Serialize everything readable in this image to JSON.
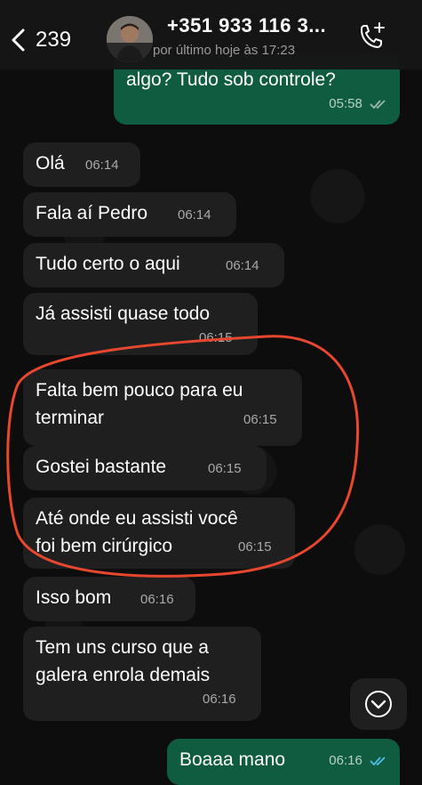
{
  "header": {
    "back_count": "239",
    "contact_name": "+351 933 116 3...",
    "last_seen": "por último hoje às 17:23"
  },
  "messages": [
    {
      "text": "algo? Tudo sob controle?",
      "time": "05:58",
      "direction": "outgoing",
      "read": true
    },
    {
      "text": "Olá",
      "time": "06:14",
      "direction": "incoming"
    },
    {
      "text": "Fala aí Pedro",
      "time": "06:14",
      "direction": "incoming"
    },
    {
      "text": "Tudo certo o aqui",
      "time": "06:14",
      "direction": "incoming"
    },
    {
      "text": "Já assisti quase todo",
      "time": "06:15",
      "direction": "incoming"
    },
    {
      "line1": "Falta bem pouco para eu",
      "line2": "terminar",
      "time": "06:15",
      "direction": "incoming"
    },
    {
      "text": "Gostei bastante",
      "time": "06:15",
      "direction": "incoming"
    },
    {
      "line1": "Até onde eu assisti você",
      "line2": "foi bem cirúrgico",
      "time": "06:15",
      "direction": "incoming"
    },
    {
      "text": "Isso bom",
      "time": "06:16",
      "direction": "incoming"
    },
    {
      "line1": "Tem uns curso que a",
      "line2": "galera enrola demais",
      "time": "06:16",
      "direction": "incoming"
    },
    {
      "text": "Boaaa mano",
      "time": "06:16",
      "direction": "outgoing",
      "read": true
    }
  ],
  "icons": {
    "back": "chevron-left-icon",
    "call": "phone-add-icon",
    "scroll": "chevron-down-circle-icon",
    "read": "double-check-icon"
  },
  "colors": {
    "incoming_bubble": "#1f1f1f",
    "outgoing_bubble": "#0f5c40",
    "read_ticks": "#53bdeb",
    "highlight_circle": "#e8472f"
  }
}
